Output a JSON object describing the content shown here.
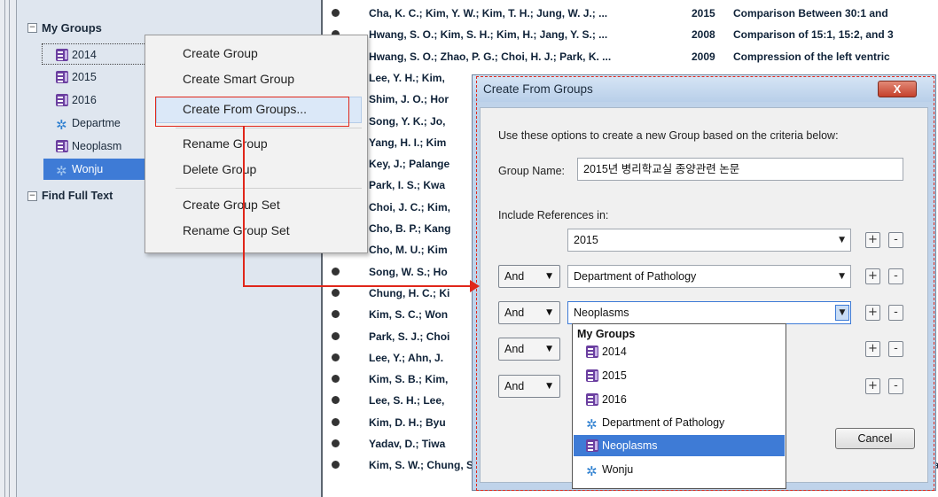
{
  "sidebar": {
    "my_groups_label": "My Groups",
    "find_full_text_label": "Find Full Text",
    "items": [
      {
        "label": "2014",
        "icon": "group-icon"
      },
      {
        "label": "2015",
        "icon": "group-icon"
      },
      {
        "label": "2016",
        "icon": "group-icon"
      },
      {
        "label": "Departme",
        "icon": "smart-group-icon"
      },
      {
        "label": "Neoplasm",
        "icon": "group-icon"
      },
      {
        "label": "Wonju",
        "icon": "smart-group-icon"
      }
    ],
    "selected": "Wonju"
  },
  "context_menu": {
    "items": [
      "Create Group",
      "Create Smart Group",
      "Create From Groups...",
      "Rename Group",
      "Delete Group",
      "Create Group Set",
      "Rename Group Set"
    ],
    "highlighted": "Create From Groups..."
  },
  "references": [
    {
      "authors": "Cha, K. C.; Kim, Y. W.; Kim, T. H.; Jung, W. J.; ...",
      "year": "2015",
      "title": "Comparison Between 30:1 and"
    },
    {
      "authors": "Hwang, S. O.; Kim, S. H.; Kim, H.; Jang, Y. S.; ...",
      "year": "2008",
      "title": "Comparison of 15:1, 15:2, and 3"
    },
    {
      "authors": "Hwang, S. O.; Zhao, P. G.; Choi, H. J.; Park, K. ...",
      "year": "2009",
      "title": "Compression of the left ventric"
    },
    {
      "authors": "Lee, Y. H.; Kim,",
      "year": "",
      "title": ""
    },
    {
      "authors": "Shim, J. O.; Hor",
      "year": "",
      "title": ""
    },
    {
      "authors": "Song, Y. K.; Jo,",
      "year": "",
      "title": ""
    },
    {
      "authors": "Yang, H. I.; Kim",
      "year": "",
      "title": ""
    },
    {
      "authors": "Key, J.; Palange",
      "year": "",
      "title": ""
    },
    {
      "authors": "Park, I. S.; Kwa",
      "year": "",
      "title": ""
    },
    {
      "authors": "Choi, J. C.; Kim,",
      "year": "",
      "title": ""
    },
    {
      "authors": "Cho, B. P.; Kang",
      "year": "",
      "title": ""
    },
    {
      "authors": "Cho, M. U.; Kim",
      "year": "",
      "title": ""
    },
    {
      "authors": "Song, W. S.; Ho",
      "year": "",
      "title": ""
    },
    {
      "authors": "Chung, H. C.; Ki",
      "year": "",
      "title": ""
    },
    {
      "authors": "Kim, S. C.; Won",
      "year": "",
      "title": ""
    },
    {
      "authors": "Park, S. J.; Choi",
      "year": "",
      "title": ""
    },
    {
      "authors": "Lee, Y.; Ahn, J.",
      "year": "",
      "title": ""
    },
    {
      "authors": "Kim, S. B.; Kim,",
      "year": "",
      "title": ""
    },
    {
      "authors": "Lee, S. H.; Lee,",
      "year": "",
      "title": ""
    },
    {
      "authors": "Kim, D. H.; Byu",
      "year": "",
      "title": ""
    },
    {
      "authors": "Yadav, D.; Tiwa",
      "year": "",
      "title": ""
    },
    {
      "authors": "Kim, S. W.; Chung, S. J.; Oh, Y.",
      "year": "",
      "title": "eeds in Patien"
    }
  ],
  "dialog": {
    "title": "Create From Groups",
    "close_label": "X",
    "instructions": "Use these options to create a new Group based on the criteria below:",
    "group_name_label": "Group Name:",
    "group_name_value": "2015년 병리학교실 종양관련 논문",
    "include_label": "Include References in:",
    "criteria": [
      {
        "operator": "",
        "value": "2015"
      },
      {
        "operator": "And",
        "value": "Department of Pathology"
      },
      {
        "operator": "And",
        "value": "Neoplasms"
      },
      {
        "operator": "And",
        "value": ""
      },
      {
        "operator": "And",
        "value": ""
      }
    ],
    "cancel_label": "Cancel",
    "plus_label": "+",
    "minus_label": "-"
  },
  "dropdown": {
    "header": "My Groups",
    "items": [
      {
        "label": "2014",
        "icon": "group-icon"
      },
      {
        "label": "2015",
        "icon": "group-icon"
      },
      {
        "label": "2016",
        "icon": "group-icon"
      },
      {
        "label": "Department of Pathology",
        "icon": "smart-group-icon"
      },
      {
        "label": "Neoplasms",
        "icon": "group-icon"
      },
      {
        "label": "Wonju",
        "icon": "smart-group-icon"
      }
    ],
    "selected": "Neoplasms"
  },
  "colors": {
    "selection_blue": "#3e7bd6",
    "annotation_red": "#e0261a",
    "group_icon_purple": "#6b3fa0",
    "smart_group_icon_blue": "#2d7fd0"
  }
}
